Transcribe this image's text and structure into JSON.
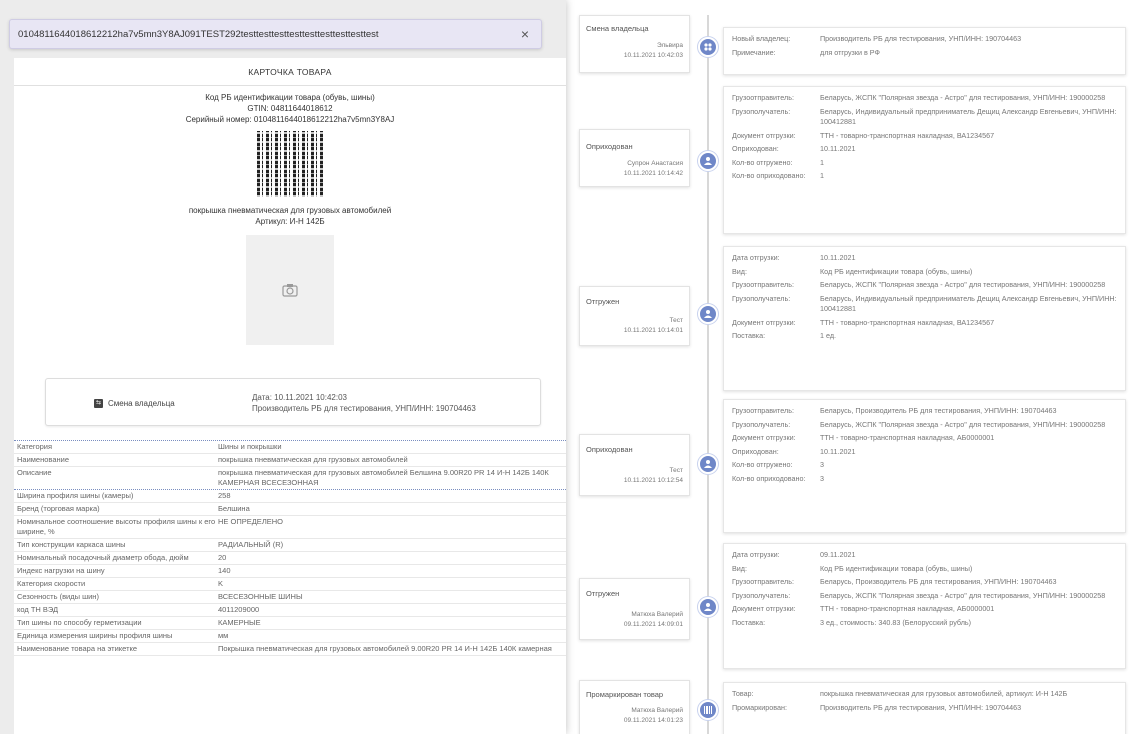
{
  "search": {
    "value": "0104811644018612212ha7v5mn3Y8AJ091TEST292testtesttesttesttesttesttesttesttest",
    "close": "×"
  },
  "card": {
    "header": "КАРТОЧКА ТОВАРА",
    "code_type": "Код РБ идентификации товара (обувь, шины)",
    "gtin": "GTIN: 04811644018612",
    "serial": "Серийный номер: 0104811644018612212ha7v5mn3Y8AJ",
    "product_name": "покрышка пневматическая для грузовых автомобилей",
    "article": "Артикул: И-Н 142Б",
    "event": {
      "label": "Смена владельца",
      "date": "Дата: 10.11.2021 10:42:03",
      "owner": "Производитель РБ для тестирования, УНП/ИНН: 190704463"
    }
  },
  "attributes": [
    {
      "key": "Категория",
      "value": "Шины и покрышки"
    },
    {
      "key": "Наименование",
      "value": "покрышка пневматическая для грузовых автомобилей"
    },
    {
      "key": "Описание",
      "value": "покрышка пневматическая для грузовых автомобилей Белшина 9.00R20 PR 14 И-Н 142Б 140К КАМЕРНАЯ ВСЕСЕЗОННАЯ"
    },
    {
      "key": "Ширина профиля шины (камеры)",
      "value": "258"
    },
    {
      "key": "Бренд (торговая марка)",
      "value": "Белшина"
    },
    {
      "key": "Номинальное соотношение высоты профиля шины к его ширине, %",
      "value": "НЕ ОПРЕДЕЛЕНО"
    },
    {
      "key": "Тип конструкции каркаса шины",
      "value": "РАДИАЛЬНЫЙ (R)"
    },
    {
      "key": "Номинальный посадочный диаметр обода, дюйм",
      "value": "20"
    },
    {
      "key": "Индекс нагрузки на шину",
      "value": "140"
    },
    {
      "key": "Категория скорости",
      "value": "K"
    },
    {
      "key": "Сезонность (виды шин)",
      "value": "ВСЕСЕЗОННЫЕ ШИНЫ"
    },
    {
      "key": "код ТН ВЭД",
      "value": "4011209000"
    },
    {
      "key": "Тип шины по способу герметизации",
      "value": "КАМЕРНЫЕ"
    },
    {
      "key": "Единица измерения ширины профиля шины",
      "value": "мм"
    },
    {
      "key": "Наименование товара на этикетке",
      "value": "Покрышка пневматическая для грузовых автомобилей 9.00R20 PR 14 И-Н 142Б 140К камерная"
    }
  ],
  "timeline": [
    {
      "title": "Смена владельца",
      "user": "Эльвира",
      "date": "10.11.2021 10:42:03",
      "icon": "group-icon",
      "details": [
        {
          "k": "Новый владелец:",
          "v": "Производитель РБ для тестирования, УНП/ИНН: 190704463"
        },
        {
          "k": "Примечание:",
          "v": "для отгрузки в РФ"
        }
      ]
    },
    {
      "title": "Оприходован",
      "user": "Супрон Анастасия",
      "date": "10.11.2021 10:14:42",
      "icon": "person-icon",
      "details": [
        {
          "k": "Грузоотправитель:",
          "v": "Беларусь, ЖСПК \"Полярная звезда - Астро\" для тестирования, УНП/ИНН: 190000258"
        },
        {
          "k": "Грузополучатель:",
          "v": "Беларусь, Индивидуальный предприниматель Дещиц Александр Евгеньевич, УНП/ИНН: 100412881"
        },
        {
          "k": "Документ отгрузки:",
          "v": "ТТН - товарно-транспортная накладная, ВА1234567"
        },
        {
          "k": "Оприходован:",
          "v": "10.11.2021"
        },
        {
          "k": "Кол-во отгружено:",
          "v": "1"
        },
        {
          "k": "Кол-во оприходовано:",
          "v": "1"
        }
      ]
    },
    {
      "title": "Отгружен",
      "user": "Тест",
      "date": "10.11.2021 10:14:01",
      "icon": "person-icon",
      "details": [
        {
          "k": "Дата отгрузки:",
          "v": "10.11.2021"
        },
        {
          "k": "Вид:",
          "v": "Код РБ идентификации товара (обувь, шины)"
        },
        {
          "k": "Грузоотправитель:",
          "v": "Беларусь, ЖСПК \"Полярная звезда - Астро\" для тестирования, УНП/ИНН: 190000258"
        },
        {
          "k": "Грузополучатель:",
          "v": "Беларусь, Индивидуальный предприниматель Дещиц Александр Евгеньевич, УНП/ИНН: 100412881"
        },
        {
          "k": "Документ отгрузки:",
          "v": "ТТН - товарно-транспортная накладная, ВА1234567"
        },
        {
          "k": "Поставка:",
          "v": "1 ед."
        }
      ]
    },
    {
      "title": "Оприходован",
      "user": "Тест",
      "date": "10.11.2021 10:12:54",
      "icon": "person-icon",
      "details": [
        {
          "k": "Грузоотправитель:",
          "v": "Беларусь, Производитель РБ для тестирования, УНП/ИНН: 190704463"
        },
        {
          "k": "Грузополучатель:",
          "v": "Беларусь, ЖСПК \"Полярная звезда - Астро\" для тестирования, УНП/ИНН: 190000258"
        },
        {
          "k": "Документ отгрузки:",
          "v": "ТТН - товарно-транспортная накладная, АБ0000001"
        },
        {
          "k": "Оприходован:",
          "v": "10.11.2021"
        },
        {
          "k": "Кол-во отгружено:",
          "v": "3"
        },
        {
          "k": "Кол-во оприходовано:",
          "v": "3"
        }
      ]
    },
    {
      "title": "Отгружен",
      "user": "Матюха Валерий",
      "date": "09.11.2021 14:09:01",
      "icon": "person-icon",
      "details": [
        {
          "k": "Дата отгрузки:",
          "v": "09.11.2021"
        },
        {
          "k": "Вид:",
          "v": "Код РБ идентификации товара (обувь, шины)"
        },
        {
          "k": "Грузоотправитель:",
          "v": "Беларусь, Производитель РБ для тестирования, УНП/ИНН: 190704463"
        },
        {
          "k": "Грузополучатель:",
          "v": "Беларусь, ЖСПК \"Полярная звезда - Астро\" для тестирования, УНП/ИНН: 190000258"
        },
        {
          "k": "Документ отгрузки:",
          "v": "ТТН - товарно-транспортная накладная, АБ0000001"
        },
        {
          "k": "Поставка:",
          "v": "3 ед., стоимость: 340.83 (Белорусский рубль)"
        }
      ]
    },
    {
      "title": "Промаркирован товар",
      "user": "Матюха Валерий",
      "date": "09.11.2021 14:01:23",
      "icon": "barcode-icon",
      "details": [
        {
          "k": "Товар:",
          "v": "покрышка пневматическая для грузовых автомобилей, артикул: И-Н 142Б"
        },
        {
          "k": "Промаркирован:",
          "v": "Производитель РБ для тестирования, УНП/ИНН: 190704463"
        }
      ]
    }
  ]
}
